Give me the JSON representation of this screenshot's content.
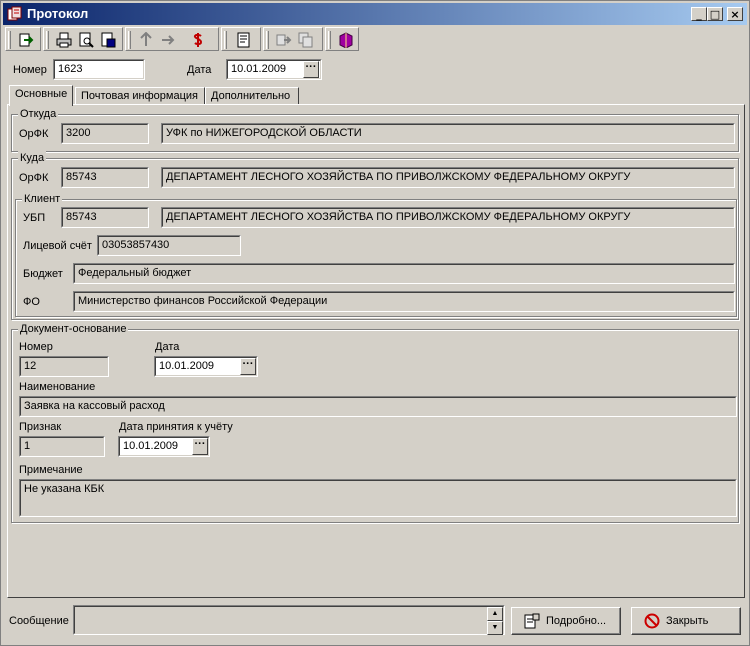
{
  "window": {
    "title": "Протокол"
  },
  "header": {
    "number_label": "Номер",
    "number_value": "1623",
    "date_label": "Дата",
    "date_value": "10.01.2009"
  },
  "tabs": [
    {
      "label": "Основные",
      "active": true
    },
    {
      "label": "Почтовая информация",
      "active": false
    },
    {
      "label": "Дополнительно",
      "active": false
    }
  ],
  "from": {
    "title": "Откуда",
    "orfk_label": "ОрФК",
    "orfk_code": "3200",
    "orfk_name": "УФК по НИЖЕГОРОДСКОЙ ОБЛАСТИ"
  },
  "to": {
    "title": "Куда",
    "orfk_label": "ОрФК",
    "orfk_code": "85743",
    "orfk_name": "ДЕПАРТАМЕНТ ЛЕСНОГО ХОЗЯЙСТВА ПО ПРИВОЛЖСКОМУ ФЕДЕРАЛЬНОМУ ОКРУГУ",
    "client": {
      "title": "Клиент",
      "ubp_label": "УБП",
      "ubp_code": "85743",
      "ubp_name": "ДЕПАРТАМЕНТ ЛЕСНОГО ХОЗЯЙСТВА ПО ПРИВОЛЖСКОМУ ФЕДЕРАЛЬНОМУ ОКРУГУ",
      "account_label": "Лицевой счёт",
      "account_value": "03053857430",
      "budget_label": "Бюджет",
      "budget_value": "Федеральный бюджет",
      "fo_label": "ФО",
      "fo_value": "Министерство финансов Российской Федерации"
    }
  },
  "basis": {
    "title": "Документ-основание",
    "number_label": "Номер",
    "number_value": "12",
    "date_label": "Дата",
    "date_value": "10.01.2009",
    "name_label": "Наименование",
    "name_value": "Заявка на кассовый расход",
    "sign_label": "Признак",
    "sign_value": "1",
    "accept_date_label": "Дата принятия к учёту",
    "accept_date_value": "10.01.2009",
    "note_label": "Примечание",
    "note_value": "Не указана КБК"
  },
  "status": {
    "message_label": "Сообщение",
    "message_value": "",
    "details_button": "Подробно...",
    "close_button": "Закрыть"
  },
  "colors": {
    "title_start": "#0a246a",
    "title_end": "#a6caf0",
    "face": "#d4d0c8",
    "close_icon": "#cc0000"
  }
}
